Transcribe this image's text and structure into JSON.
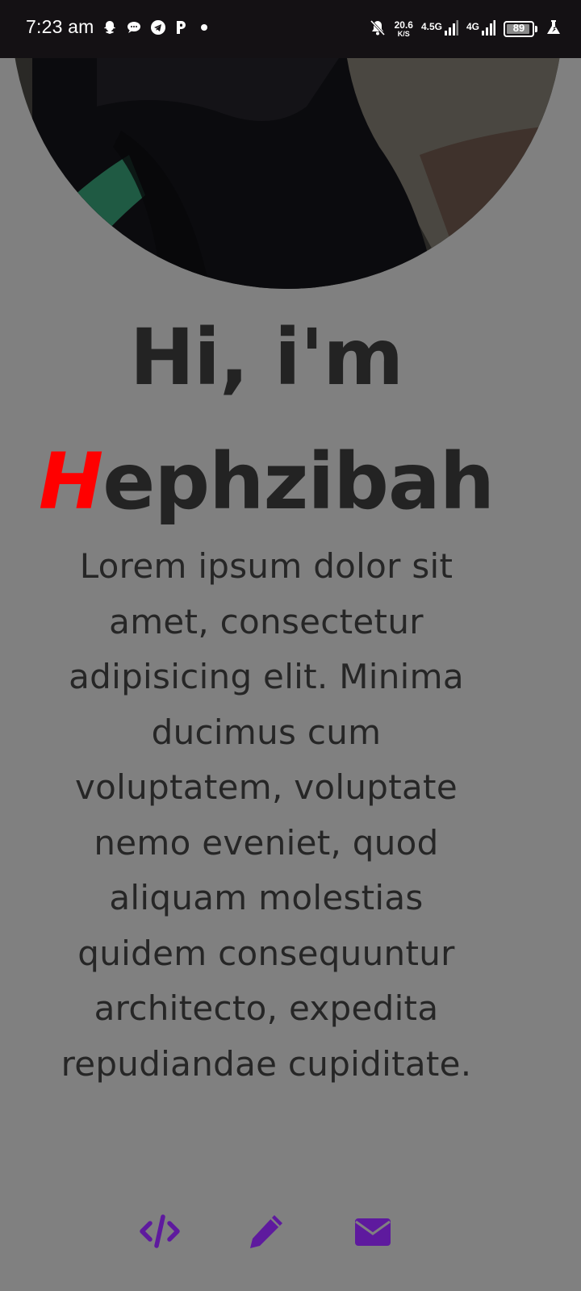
{
  "status_bar": {
    "time": "7:23 am",
    "network_speed": "20.6",
    "network_speed_unit": "K/S",
    "network_type_1": "4.5G",
    "network_type_2": "4G",
    "battery_level": "89"
  },
  "hero": {
    "greeting": "Hi, i'm",
    "name_initial": "H",
    "name_rest": "ephzibah",
    "bio": "Lorem ipsum dolor sit amet, consectetur adipisicing elit. Minima ducimus cum voluptatem, voluptate nemo eveniet, quod aliquam molestias quidem consequuntur architecto, expedita repudiandae cupiditate."
  },
  "social_links": [
    {
      "icon": "code-icon"
    },
    {
      "icon": "pencil-icon"
    },
    {
      "icon": "envelope-icon"
    }
  ],
  "colors": {
    "background": "#808080",
    "heading_text": "#232323",
    "body_text": "#262626",
    "name_accent": "#ff0000",
    "icon_accent": "#5e1a9e",
    "status_bar": "#141114"
  }
}
